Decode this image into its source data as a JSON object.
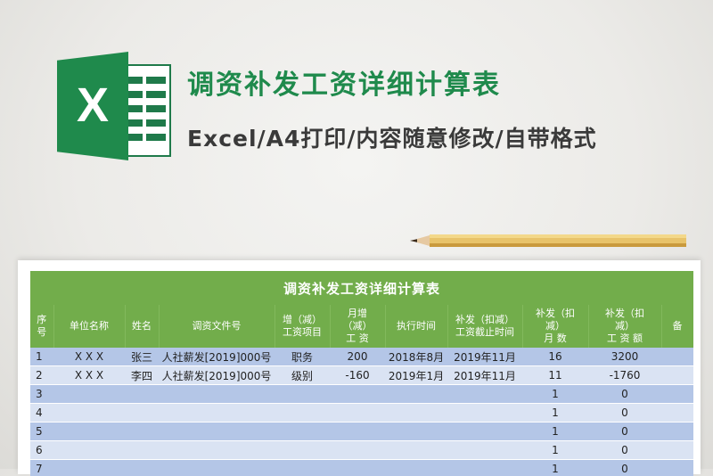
{
  "header": {
    "title": "调资补发工资详细计算表",
    "subtitle": "Excel/A4打印/内容随意修改/自带格式",
    "logo_letter": "X"
  },
  "colors": {
    "excel_green": "#1f8a4c",
    "sheet_header_green": "#72ad4b",
    "row_blue_dark": "#b4c6e7",
    "row_blue_light": "#dae3f3"
  },
  "sheet": {
    "banner_title": "调资补发工资详细计算表",
    "columns": [
      "序\n号",
      "单位名称",
      "姓名",
      "调资文件号",
      "增（减）\n工资项目",
      "月增\n（减）\n工  资",
      "执行时间",
      "补发（扣减）\n工资截止时间",
      "补发（扣\n减）\n月  数",
      "补发（扣\n减）\n工 资 额",
      "备"
    ],
    "rows": [
      [
        "1",
        "X X X",
        "张三",
        "人社薪发[2019]000号",
        "职务",
        "200",
        "2018年8月",
        "2019年11月",
        "16",
        "3200",
        ""
      ],
      [
        "2",
        "X X X",
        "李四",
        "人社薪发[2019]000号",
        "级别",
        "-160",
        "2019年1月",
        "2019年11月",
        "11",
        "-1760",
        ""
      ],
      [
        "3",
        "",
        "",
        "",
        "",
        "",
        "",
        "",
        "1",
        "0",
        ""
      ],
      [
        "4",
        "",
        "",
        "",
        "",
        "",
        "",
        "",
        "1",
        "0",
        ""
      ],
      [
        "5",
        "",
        "",
        "",
        "",
        "",
        "",
        "",
        "1",
        "0",
        ""
      ],
      [
        "6",
        "",
        "",
        "",
        "",
        "",
        "",
        "",
        "1",
        "0",
        ""
      ],
      [
        "7",
        "",
        "",
        "",
        "",
        "",
        "",
        "",
        "1",
        "0",
        ""
      ]
    ]
  }
}
